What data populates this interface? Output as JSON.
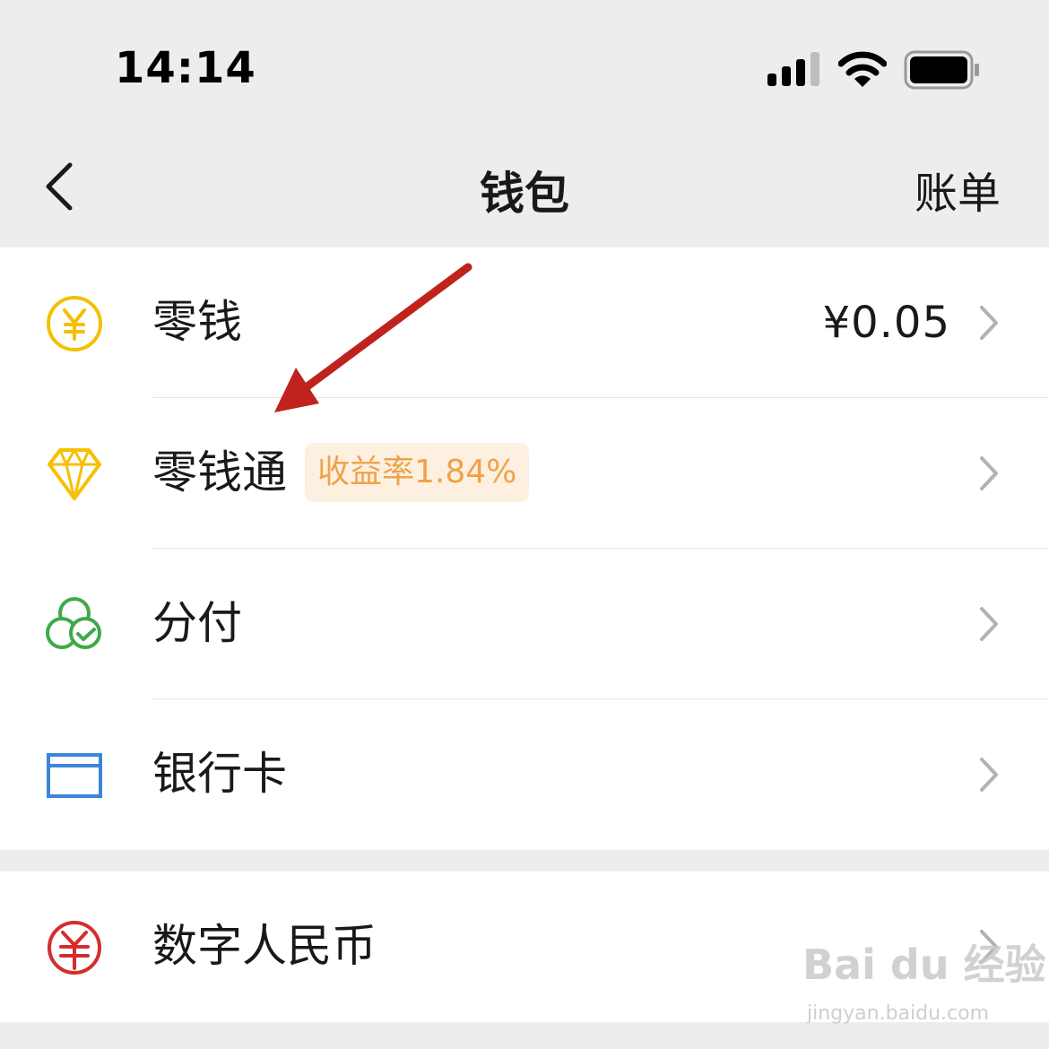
{
  "status_bar": {
    "time": "14:14"
  },
  "nav": {
    "title": "钱包",
    "right_action": "账单"
  },
  "wallet_items": [
    {
      "label": "零钱",
      "value": "¥0.05",
      "icon": "yuan-coin-icon",
      "color": "#f5c000"
    },
    {
      "label": "零钱通",
      "badge": "收益率1.84%",
      "icon": "diamond-icon",
      "color": "#f5c000"
    },
    {
      "label": "分付",
      "icon": "clover-check-icon",
      "color": "#3fa947"
    },
    {
      "label": "银行卡",
      "icon": "bank-card-icon",
      "color": "#3b86d8"
    }
  ],
  "digital_rmb": {
    "label": "数字人民币",
    "icon": "digital-rmb-icon",
    "color": "#d42d2d"
  },
  "watermark": {
    "brand": "Bai du 经验",
    "url": "jingyan.baidu.com"
  }
}
